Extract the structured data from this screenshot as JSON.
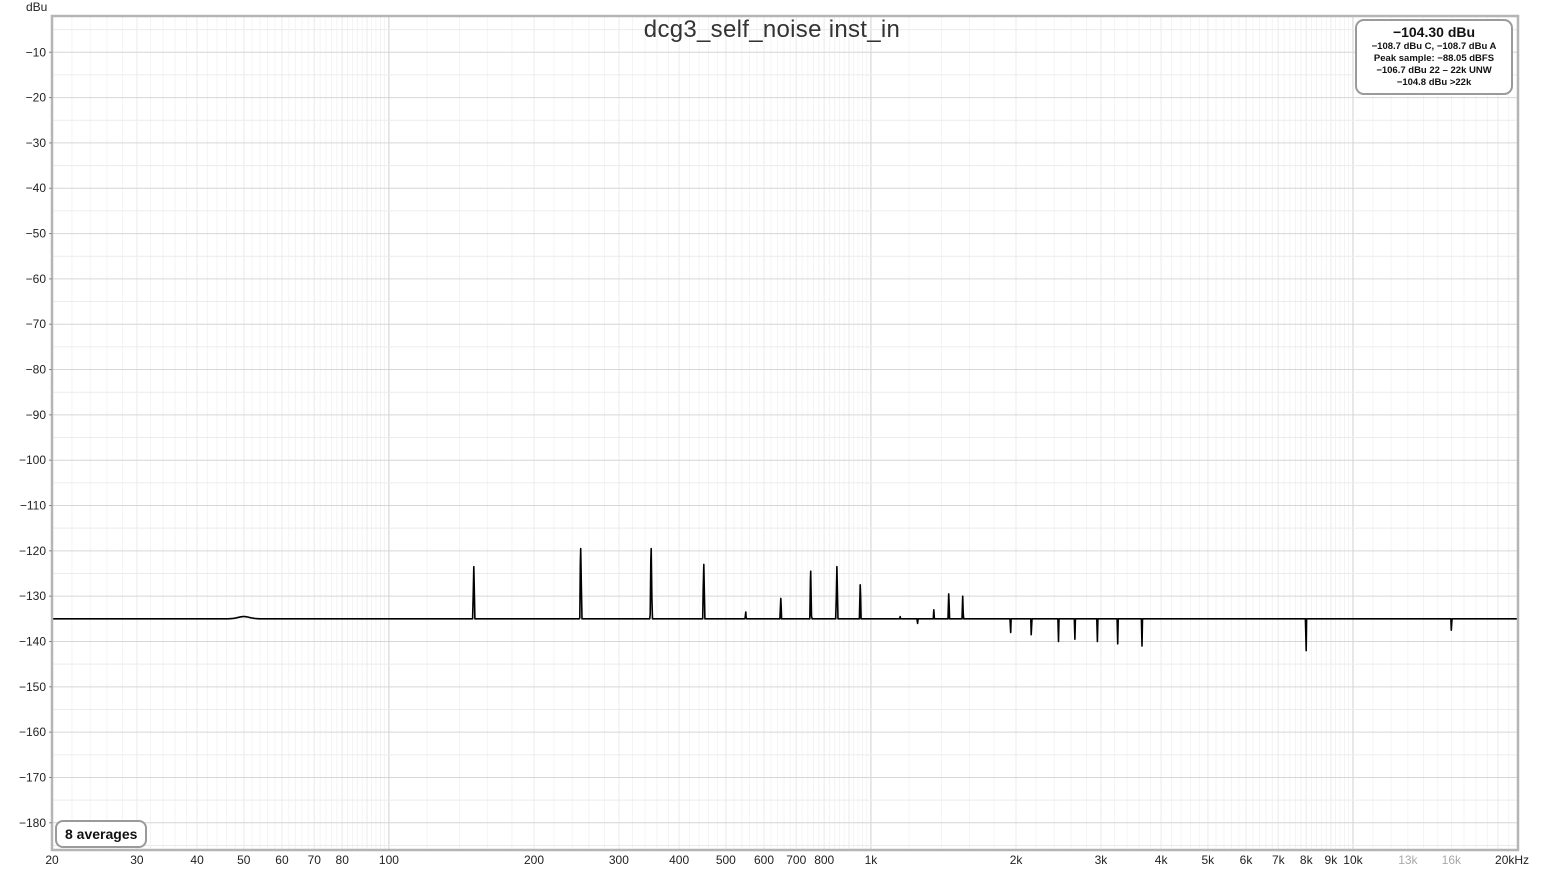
{
  "title": "dcg3_self_noise inst_in",
  "y_unit": "dBu",
  "legend": {
    "main": "−104.30 dBu",
    "lines": [
      "−108.7 dBu C, −108.7 dBu A",
      "Peak sample: −88.05 dBFS",
      "−106.7 dBu 22 – 22k UNW",
      "−104.8 dBu >22k"
    ]
  },
  "averages_label": "8 averages",
  "colors": {
    "trace": "#000000",
    "grid_minor": "#e3e3e3",
    "grid_major": "#b0b0b0",
    "frame": "#b5b5b5"
  },
  "chart_data": {
    "type": "line",
    "title": "dcg3_self_noise inst_in",
    "xlabel": "",
    "ylabel": "dBu",
    "x_scale": "log",
    "xlim": [
      20,
      22000
    ],
    "ylim": [
      -186,
      -2
    ],
    "grid": true,
    "x_tick_labels": [
      {
        "value": 20,
        "label": "20"
      },
      {
        "value": 30,
        "label": "30"
      },
      {
        "value": 40,
        "label": "40"
      },
      {
        "value": 50,
        "label": "50"
      },
      {
        "value": 60,
        "label": "60"
      },
      {
        "value": 70,
        "label": "70"
      },
      {
        "value": 80,
        "label": "80"
      },
      {
        "value": 100,
        "label": "100"
      },
      {
        "value": 200,
        "label": "200"
      },
      {
        "value": 300,
        "label": "300"
      },
      {
        "value": 400,
        "label": "400"
      },
      {
        "value": 500,
        "label": "500"
      },
      {
        "value": 600,
        "label": "600"
      },
      {
        "value": 700,
        "label": "700"
      },
      {
        "value": 800,
        "label": "800"
      },
      {
        "value": 1000,
        "label": "1k"
      },
      {
        "value": 2000,
        "label": "2k"
      },
      {
        "value": 3000,
        "label": "3k"
      },
      {
        "value": 4000,
        "label": "4k"
      },
      {
        "value": 5000,
        "label": "5k"
      },
      {
        "value": 6000,
        "label": "6k"
      },
      {
        "value": 7000,
        "label": "7k"
      },
      {
        "value": 8000,
        "label": "8k"
      },
      {
        "value": 9000,
        "label": "9k"
      },
      {
        "value": 10000,
        "label": "10k"
      },
      {
        "value": 13000,
        "label": "13k",
        "muted": true
      },
      {
        "value": 16000,
        "label": "16k",
        "muted": true
      },
      {
        "value": 20000,
        "label": "20kHz"
      }
    ],
    "y_ticks": [
      -10,
      -20,
      -30,
      -40,
      -50,
      -60,
      -70,
      -80,
      -90,
      -100,
      -110,
      -120,
      -130,
      -140,
      -150,
      -160,
      -170,
      -180
    ],
    "series": [
      {
        "noise_floor": [
          [
            20,
            -149.5
          ],
          [
            22,
            -149
          ],
          [
            24,
            -147.5
          ],
          [
            26,
            -145.5
          ],
          [
            27,
            -143.5
          ],
          [
            28.5,
            -143
          ],
          [
            30,
            -145
          ],
          [
            31,
            -148.5
          ],
          [
            32,
            -149
          ],
          [
            33,
            -147
          ],
          [
            35,
            -146.5
          ],
          [
            38,
            -146.8
          ],
          [
            40,
            -147
          ],
          [
            41,
            -149.5
          ],
          [
            42,
            -146.5
          ],
          [
            43.5,
            -148
          ],
          [
            45,
            -147
          ],
          [
            46,
            -149.5
          ],
          [
            47,
            -148.5
          ],
          [
            48,
            -150
          ],
          [
            49,
            -148
          ],
          [
            50,
            -135
          ],
          [
            51,
            -140
          ],
          [
            52,
            -146
          ],
          [
            55,
            -146.5
          ],
          [
            58,
            -147
          ],
          [
            62,
            -146.5
          ],
          [
            66,
            -147
          ],
          [
            70,
            -147
          ],
          [
            75,
            -147
          ],
          [
            80,
            -147.5
          ],
          [
            90,
            -147.5
          ],
          [
            100,
            -148
          ],
          [
            130,
            -148
          ],
          [
            180,
            -147.5
          ],
          [
            250,
            -147.5
          ],
          [
            400,
            -148
          ],
          [
            700,
            -148.5
          ],
          [
            1000,
            -149
          ],
          [
            2000,
            -149.5
          ],
          [
            4000,
            -150
          ],
          [
            7000,
            -151
          ],
          [
            10000,
            -152
          ],
          [
            15000,
            -152.5
          ],
          [
            21500,
            -153
          ]
        ],
        "peaks": [
          [
            50,
            -134.5
          ],
          [
            150,
            -123.5
          ],
          [
            250,
            -119.5
          ],
          [
            350,
            -119.5
          ],
          [
            450,
            -123
          ],
          [
            550,
            -133.5
          ],
          [
            650,
            -130.5
          ],
          [
            750,
            -124.5
          ],
          [
            850,
            -123.5
          ],
          [
            950,
            -127.5
          ],
          [
            1150,
            -134.5
          ],
          [
            1250,
            -136
          ],
          [
            1350,
            -133
          ],
          [
            1450,
            -129.5
          ],
          [
            1550,
            -130
          ],
          [
            1650,
            -135
          ],
          [
            1950,
            -138
          ],
          [
            2150,
            -138.5
          ],
          [
            2450,
            -140
          ],
          [
            2650,
            -139.5
          ],
          [
            2950,
            -140
          ],
          [
            3250,
            -140.5
          ],
          [
            3650,
            -141
          ],
          [
            8000,
            -142
          ],
          [
            16000,
            -137.5
          ]
        ]
      }
    ]
  }
}
